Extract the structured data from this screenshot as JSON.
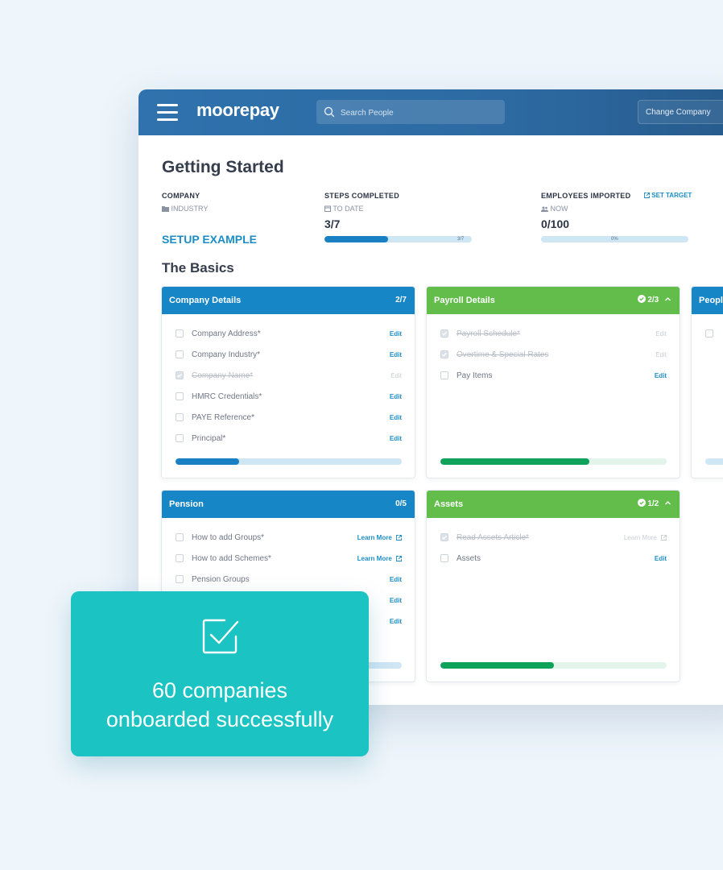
{
  "header": {
    "logo": "moorepay",
    "search_placeholder": "Search People",
    "change_company": "Change Company"
  },
  "page": {
    "title": "Getting Started",
    "company_label": "COMPANY",
    "industry_label": "INDUSTRY",
    "company_name": "SETUP EXAMPLE",
    "steps_label": "STEPS COMPLETED",
    "steps_sub": "TO DATE",
    "steps_value": "3/7",
    "steps_bar_text": "3/7",
    "steps_progress": 0.43,
    "employees_label": "EMPLOYEES IMPORTED",
    "employees_sub": "NOW",
    "employees_value": "0/100",
    "employees_bar_text": "0%",
    "employees_progress": 0,
    "set_target": "SET TARGET",
    "section_title": "The Basics"
  },
  "cards": {
    "company": {
      "title": "Company Details",
      "count": "2/7",
      "progress": 0.28,
      "items": [
        {
          "label": "Company Address*",
          "action": "Edit",
          "done": false
        },
        {
          "label": "Company Industry*",
          "action": "Edit",
          "done": false
        },
        {
          "label": "Company Name*",
          "action": "Edit",
          "done": true
        },
        {
          "label": "HMRC Credentials*",
          "action": "Edit",
          "done": false
        },
        {
          "label": "PAYE Reference*",
          "action": "Edit",
          "done": false
        },
        {
          "label": "Principal*",
          "action": "Edit",
          "done": false
        }
      ]
    },
    "payroll": {
      "title": "Payroll Details",
      "count": "2/3",
      "progress": 0.66,
      "items": [
        {
          "label": "Payroll Schedule*",
          "action": "Edit",
          "done": true
        },
        {
          "label": "Overtime & Special Rates",
          "action": "Edit",
          "done": true
        },
        {
          "label": "Pay Items",
          "action": "Edit",
          "done": false
        }
      ]
    },
    "people": {
      "title": "People"
    },
    "pension": {
      "title": "Pension",
      "count": "0/5",
      "progress": 0.0,
      "items": [
        {
          "label": "How to add Groups*",
          "action": "Learn More",
          "done": false
        },
        {
          "label": "How to add Schemes*",
          "action": "Learn More",
          "done": false
        },
        {
          "label": "Pension Groups",
          "action": "Edit",
          "done": false
        },
        {
          "label": "",
          "action": "Edit",
          "done": false
        },
        {
          "label": "",
          "action": "Edit",
          "done": false
        }
      ]
    },
    "assets": {
      "title": "Assets",
      "count": "1/2",
      "progress": 0.5,
      "items": [
        {
          "label": "Read Assets Article*",
          "action": "Learn More",
          "done": true
        },
        {
          "label": "Assets",
          "action": "Edit",
          "done": false
        }
      ]
    }
  },
  "toast": {
    "line1": "60 companies",
    "line2": "onboarded successfully"
  },
  "colors": {
    "blue_header": "#1686c7",
    "green_header": "#62bd4b",
    "blue_fill": "#1a80c4",
    "green_fill": "#0fa25a",
    "toast": "#1cc3c3"
  }
}
